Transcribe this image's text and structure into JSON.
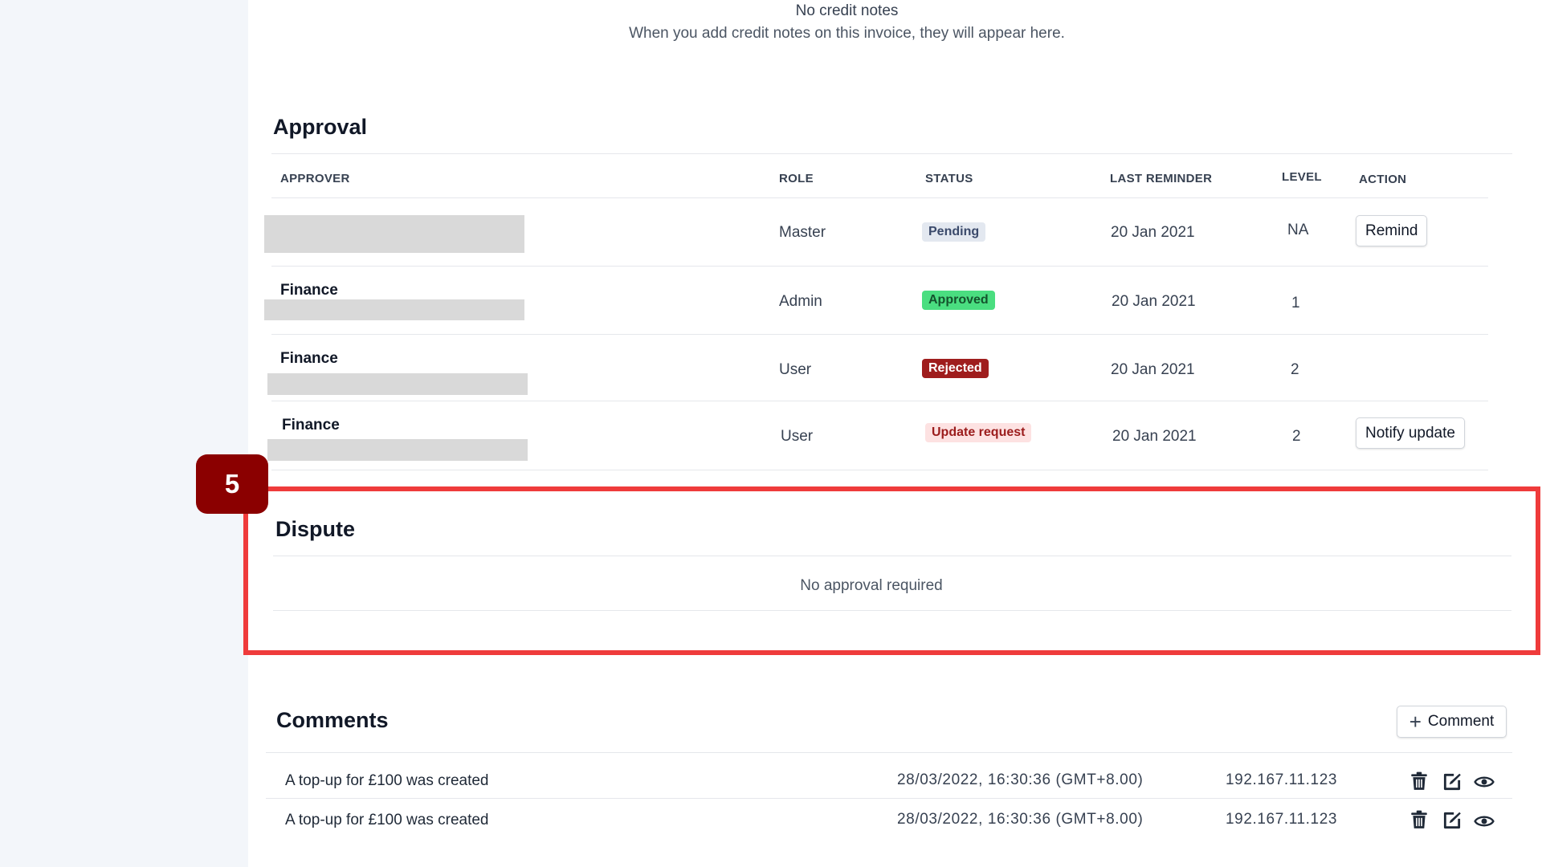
{
  "credit_notes": {
    "empty_title": "No credit notes",
    "empty_desc": "When you add credit notes on this invoice, they will appear here."
  },
  "approval": {
    "title": "Approval",
    "columns": {
      "approver": "APPROVER",
      "role": "ROLE",
      "status": "STATUS",
      "last_reminder": "LAST REMINDER",
      "level": "LEVEL",
      "action": "ACTION"
    },
    "rows": [
      {
        "approver": "",
        "role": "Master",
        "status": "Pending",
        "last_reminder": "20 Jan 2021",
        "level": "NA",
        "action": "Remind"
      },
      {
        "approver": "Finance",
        "role": "Admin",
        "status": "Approved",
        "last_reminder": "20 Jan 2021",
        "level": "1",
        "action": ""
      },
      {
        "approver": "Finance",
        "role": "User",
        "status": "Rejected",
        "last_reminder": "20 Jan 2021",
        "level": "2",
        "action": ""
      },
      {
        "approver": "Finance",
        "role": "User",
        "status": "Update request",
        "last_reminder": "20 Jan 2021",
        "level": "2",
        "action": "Notify update"
      }
    ]
  },
  "callout": {
    "number": "5",
    "color": "#ef3b3b"
  },
  "dispute": {
    "title": "Dispute",
    "empty_text": "No approval required"
  },
  "comments": {
    "title": "Comments",
    "add_label": "Comment",
    "rows": [
      {
        "text": "A top-up for £100 was created",
        "timestamp": "28/03/2022, 16:30:36 (GMT+8.00)",
        "ip": "192.167.11.123"
      },
      {
        "text": "A top-up for £100 was created",
        "timestamp": "28/03/2022, 16:30:36 (GMT+8.00)",
        "ip": "192.167.11.123"
      }
    ],
    "row_icons": [
      "trash-icon",
      "edit-icon",
      "eye-icon"
    ]
  },
  "colors": {
    "pending_bg": "#e3e8f0",
    "approved_bg": "#4ade80",
    "rejected_bg": "#9f1d1d",
    "update_request_bg": "#fde2e2",
    "callout_badge": "#8b0000"
  }
}
